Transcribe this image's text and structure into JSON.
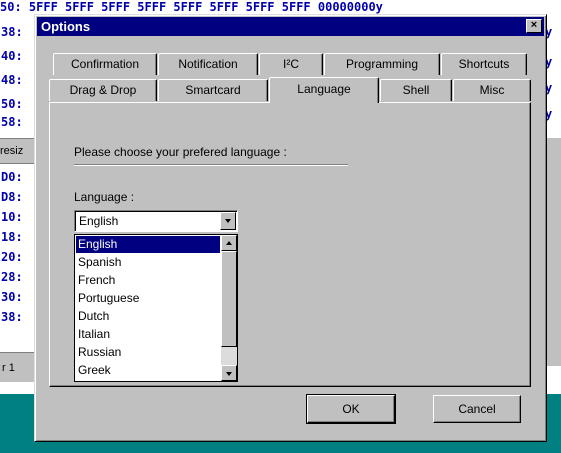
{
  "background": {
    "top_text": "50:  5FFF  5FFF  5FFF  5FFF  5FFF  5FFF  5FFF  5FFF  00000000y",
    "left_lines": [
      "38:",
      "40:",
      "48:",
      "50:",
      "58:",
      "",
      "",
      "D0:",
      "D8:",
      "10:",
      "18:",
      "20:",
      "28:",
      "30:",
      "38:"
    ],
    "resize_text": "resiz",
    "status_text": "r 1",
    "right_lines": [
      "y",
      "y",
      "y",
      "y"
    ]
  },
  "dialog": {
    "title": "Options",
    "close_icon": "close-icon",
    "tabs_row1": [
      "Confirmation",
      "Notification",
      "I²C",
      "Programming",
      "Shortcuts"
    ],
    "tabs_row2": [
      "Drag & Drop",
      "Smartcard",
      "Language",
      "Shell",
      "Misc"
    ],
    "active_tab": "Language",
    "prompt": "Please choose your prefered language :",
    "language_label": "Language :",
    "selected_language": "English",
    "language_options": [
      "English",
      "Spanish",
      "French",
      "Portuguese",
      "Dutch",
      "Italian",
      "Russian",
      "Greek"
    ],
    "ok_label": "OK",
    "cancel_label": "Cancel"
  },
  "colors": {
    "titlebar": "#000080",
    "selection": "#000080",
    "face": "#c0c0c0",
    "desktop": "#008080"
  }
}
